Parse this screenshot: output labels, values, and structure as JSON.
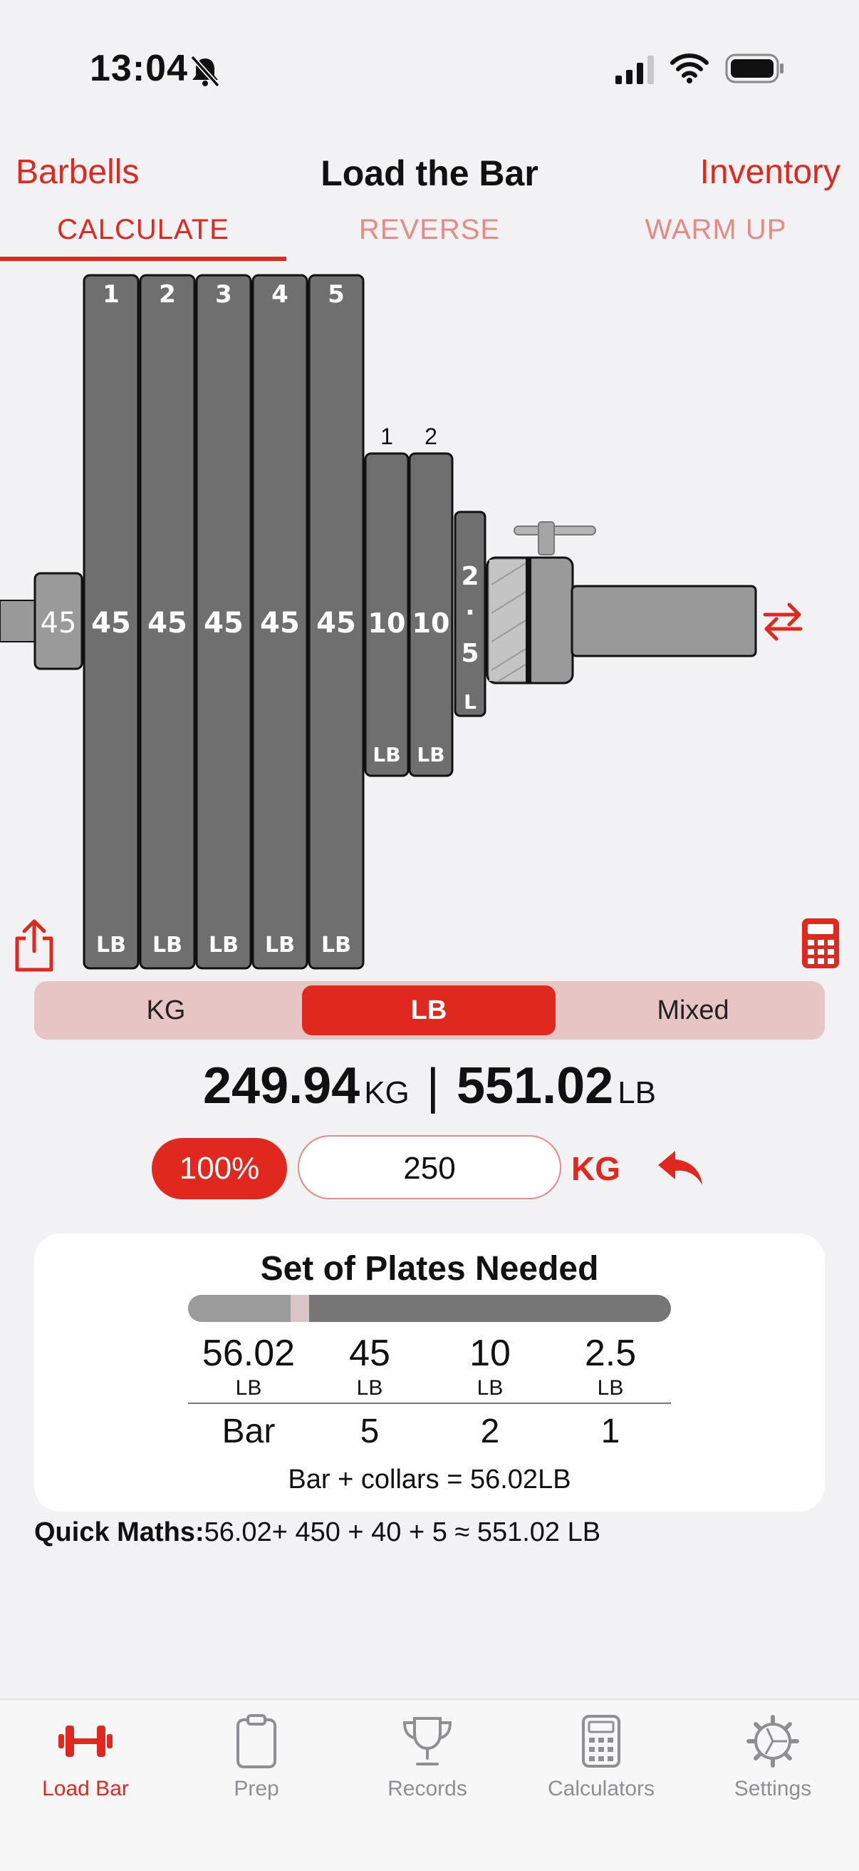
{
  "status": {
    "time": "13:04"
  },
  "nav": {
    "left": "Barbells",
    "title": "Load the Bar",
    "right": "Inventory"
  },
  "tabs": [
    {
      "label": "CALCULATE"
    },
    {
      "label": "REVERSE"
    },
    {
      "label": "WARM UP"
    }
  ],
  "bar_diagram": {
    "collar_plate": "45",
    "big_plates": [
      {
        "index": "1",
        "value": "45",
        "unit": "LB"
      },
      {
        "index": "2",
        "value": "45",
        "unit": "LB"
      },
      {
        "index": "3",
        "value": "45",
        "unit": "LB"
      },
      {
        "index": "4",
        "value": "45",
        "unit": "LB"
      },
      {
        "index": "5",
        "value": "45",
        "unit": "LB"
      }
    ],
    "mid_plates": [
      {
        "index": "1",
        "value": "10",
        "unit": "LB"
      },
      {
        "index": "2",
        "value": "10",
        "unit": "LB"
      }
    ],
    "small_plate": {
      "chars": [
        "2",
        ".",
        "5"
      ],
      "unit": "L"
    }
  },
  "units": {
    "kg": "KG",
    "lb": "LB",
    "mixed": "Mixed",
    "selected": "LB"
  },
  "total": {
    "kg_value": "249.94",
    "kg_unit": "KG",
    "lb_value": "551.02",
    "lb_unit": "LB"
  },
  "input": {
    "percent": "100%",
    "weight": "250",
    "unit": "KG"
  },
  "plates_needed": {
    "title": "Set of Plates Needed",
    "columns": [
      {
        "weight": "56.02",
        "unit": "LB",
        "count": "Bar"
      },
      {
        "weight": "45",
        "unit": "LB",
        "count": "5"
      },
      {
        "weight": "10",
        "unit": "LB",
        "count": "2"
      },
      {
        "weight": "2.5",
        "unit": "LB",
        "count": "1"
      }
    ],
    "collars_note": "Bar + collars = 56.02LB"
  },
  "quick_maths": {
    "label": "Quick Maths:",
    "text": "56.02+ 450 + 40 + 5  ≈ 551.02 LB"
  },
  "tabbar": [
    {
      "label": "Load Bar",
      "icon": "dumbbell-icon"
    },
    {
      "label": "Prep",
      "icon": "clipboard-icon"
    },
    {
      "label": "Records",
      "icon": "trophy-icon"
    },
    {
      "label": "Calculators",
      "icon": "calculator-icon"
    },
    {
      "label": "Settings",
      "icon": "gear-icon"
    }
  ],
  "colors": {
    "accent": "#e0281e",
    "plate": "#6f6f6f",
    "segment_bg": "#e8c5c5"
  }
}
